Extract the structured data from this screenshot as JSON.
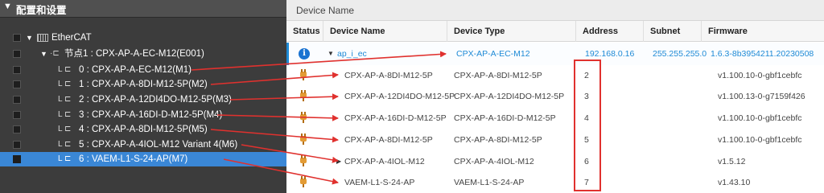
{
  "tree": {
    "header": "配置和设置",
    "ethercat_label": "EtherCAT",
    "node_label": "节点1 : CPX-AP-A-EC-M12(E001)",
    "items": [
      {
        "label": "0 : CPX-AP-A-EC-M12(M1)"
      },
      {
        "label": "1 : CPX-AP-A-8DI-M12-5P(M2)"
      },
      {
        "label": "2 : CPX-AP-A-12DI4DO-M12-5P(M3)"
      },
      {
        "label": "3 : CPX-AP-A-16DI-D-M12-5P(M4)"
      },
      {
        "label": "4 : CPX-AP-A-8DI-M12-5P(M5)"
      },
      {
        "label": "5 : CPX-AP-A-4IOL-M12 Variant 4(M6)"
      },
      {
        "label": "6 : VAEM-L1-S-24-AP(M7)"
      }
    ]
  },
  "devices": {
    "panel_title": "Device Name",
    "columns": {
      "status": "Status",
      "name": "Device Name",
      "type": "Device Type",
      "address": "Address",
      "subnet": "Subnet Mask",
      "firmware": "Firmware"
    },
    "head": {
      "name": "ap_i_ec",
      "type": "CPX-AP-A-EC-M12",
      "address": "192.168.0.16",
      "subnet": "255.255.255.0",
      "firmware": "1.6.3-8b3954211.20230508"
    },
    "rows": [
      {
        "name": "CPX-AP-A-8DI-M12-5P",
        "type": "CPX-AP-A-8DI-M12-5P",
        "address": "2",
        "firmware": "v1.100.10-0-gbf1cebfc"
      },
      {
        "name": "CPX-AP-A-12DI4DO-M12-5P",
        "type": "CPX-AP-A-12DI4DO-M12-5P",
        "address": "3",
        "firmware": "v1.100.13-0-g7159f426"
      },
      {
        "name": "CPX-AP-A-16DI-D-M12-5P",
        "type": "CPX-AP-A-16DI-D-M12-5P",
        "address": "4",
        "firmware": "v1.100.10-0-gbf1cebfc"
      },
      {
        "name": "CPX-AP-A-8DI-M12-5P",
        "type": "CPX-AP-A-8DI-M12-5P",
        "address": "5",
        "firmware": "v1.100.10-0-gbf1cebfc"
      },
      {
        "name": "CPX-AP-A-4IOL-M12",
        "type": "CPX-AP-A-4IOL-M12",
        "address": "6",
        "firmware": "v1.5.12"
      },
      {
        "name": "VAEM-L1-S-24-AP",
        "type": "VAEM-L1-S-24-AP",
        "address": "7",
        "firmware": "v1.43.10"
      }
    ]
  },
  "colors": {
    "annotation_red": "#e0312e",
    "link_blue": "#1e8ad6",
    "selected_blue": "#3a87d6",
    "tree_bg": "#3c3c3c"
  }
}
